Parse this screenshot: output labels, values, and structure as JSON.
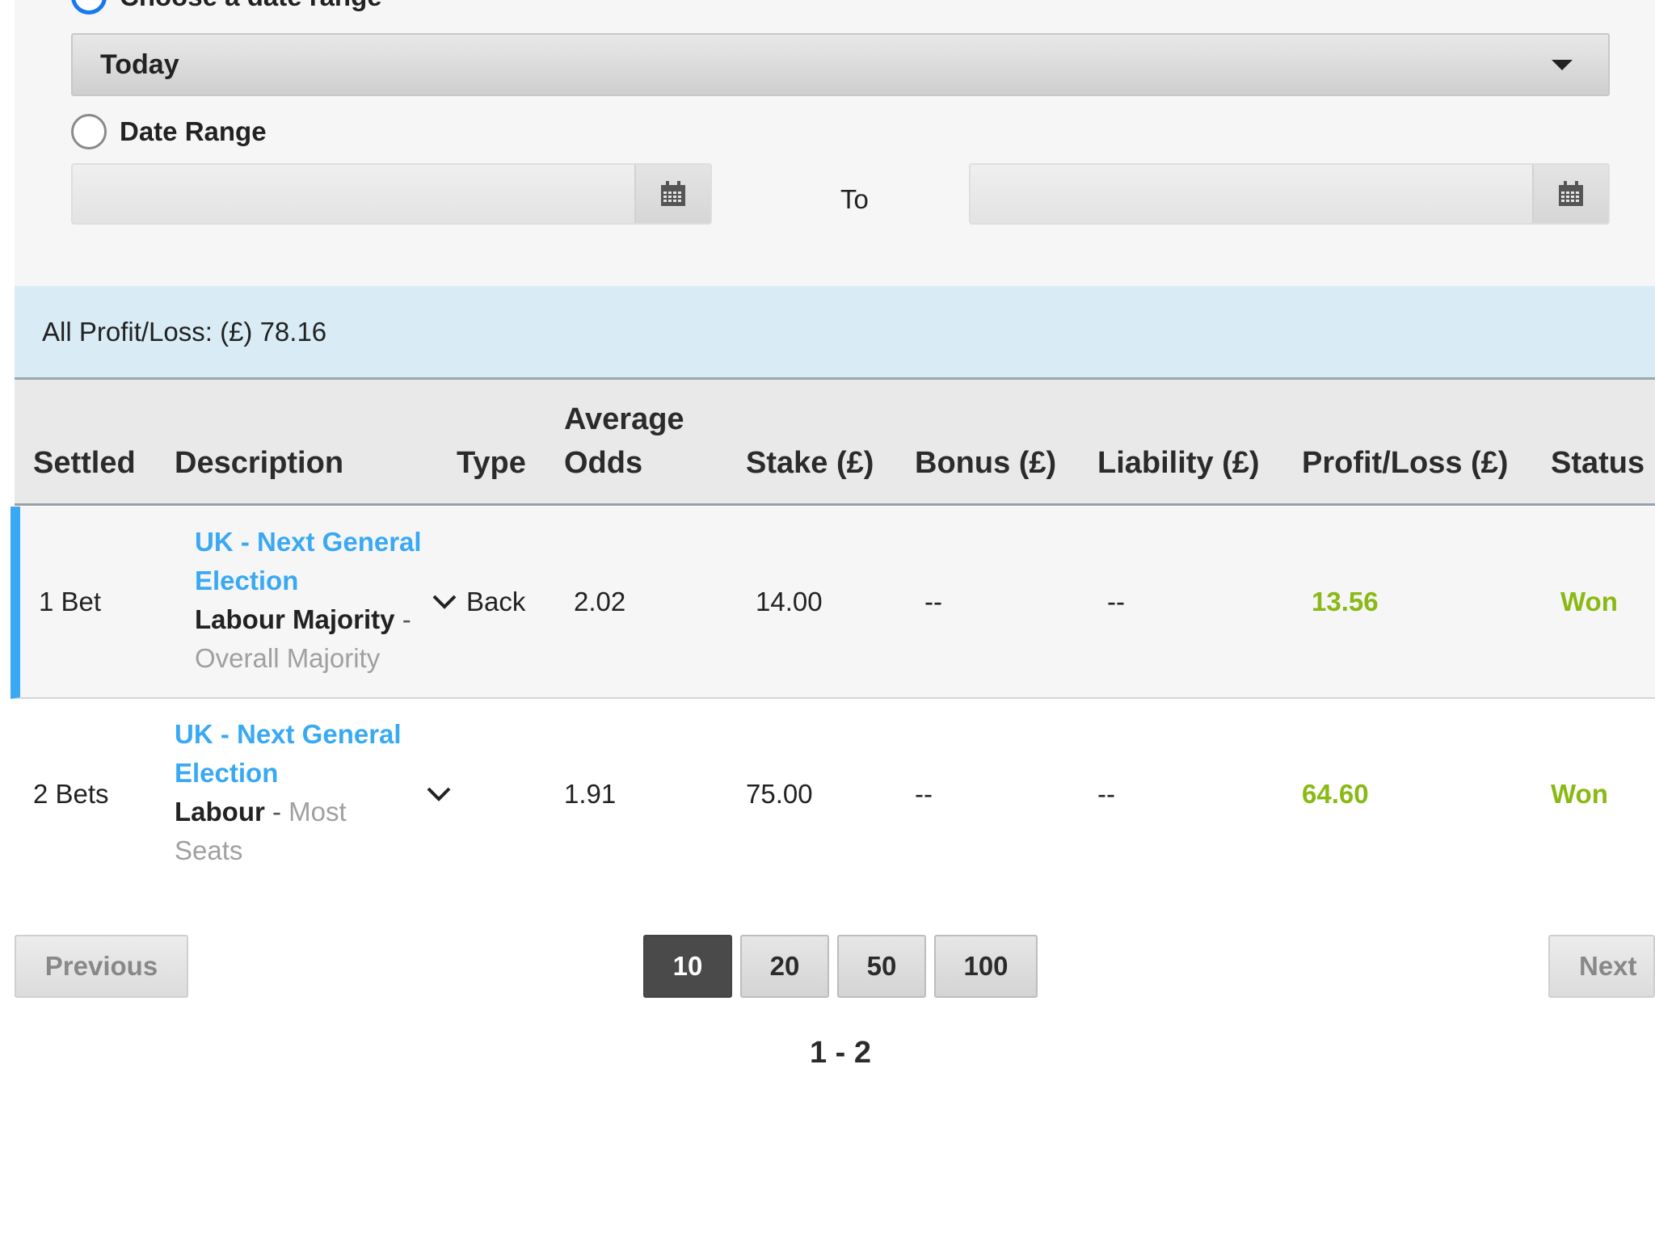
{
  "filters": {
    "choose_range_label": "Choose a date range",
    "selected_range": "Today",
    "date_range_label": "Date Range",
    "to_label": "To",
    "from_value": "",
    "to_value": ""
  },
  "summary": {
    "label": "All Profit/Loss: (£) 78.16"
  },
  "table": {
    "headers": {
      "settled": "Settled",
      "description": "Description",
      "type": "Type",
      "average_odds_1": "Average",
      "average_odds_2": "Odds",
      "stake": "Stake (£)",
      "bonus": "Bonus (£)",
      "liability": "Liability (£)",
      "profit_loss": "Profit/Loss (£)",
      "status": "Status"
    },
    "rows": [
      {
        "settled": "1 Bet",
        "event_1": "UK - Next General",
        "event_2": "Election",
        "selection": "Labour Majority",
        "sep": " -",
        "market": "Overall Majority",
        "type": "Back",
        "odds": "2.02",
        "stake": "14.00",
        "bonus": "--",
        "liability": "--",
        "profit_loss": "13.56",
        "status": "Won"
      },
      {
        "settled": "2 Bets",
        "event_1": "UK - Next General",
        "event_2": "Election",
        "selection": "Labour",
        "sep": " - ",
        "market_1": "Most",
        "market_2": "Seats",
        "type": "",
        "odds": "1.91",
        "stake": "75.00",
        "bonus": "--",
        "liability": "--",
        "profit_loss": "64.60",
        "status": "Won"
      }
    ]
  },
  "pagination": {
    "previous": "Previous",
    "next": "Next",
    "page_sizes": [
      "10",
      "20",
      "50",
      "100"
    ],
    "active_page_size": "10",
    "range": "1 - 2"
  },
  "colors": {
    "link_blue": "#3aa9f3",
    "win_green": "#8ab915",
    "radio_blue": "#1877f2",
    "summary_bg": "#d9ecf6"
  }
}
